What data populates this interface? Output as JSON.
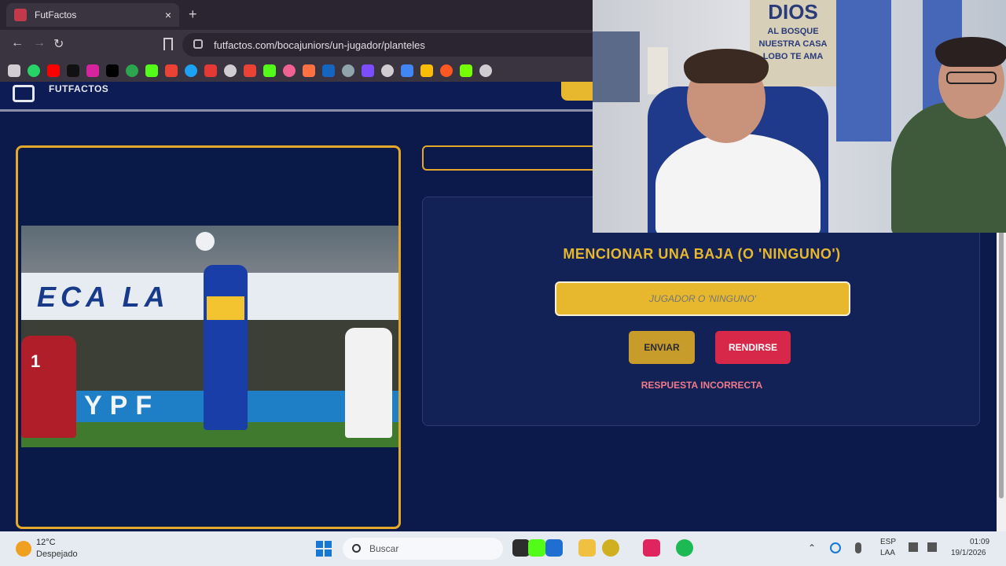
{
  "browser": {
    "tab_title": "FutFactos",
    "tab_close": "×",
    "new_tab": "+",
    "url": "futfactos.com/bocajuniors/un-jugador/planteles"
  },
  "site": {
    "name": "FUTFACTOS"
  },
  "game": {
    "question": "MENCIONAR UNA BAJA (O 'NINGUNO')",
    "input_placeholder": "JUGADOR O 'NINGUNO'",
    "input_value": "",
    "send_label": "ENVIAR",
    "giveup_label": "RENDIRSE",
    "feedback": "RESPUESTA INCORRECTA"
  },
  "photo": {
    "banner_text": "ECA LA",
    "adboard_text": "YPF",
    "player_number": "1"
  },
  "webcam": {
    "poster_title": "DIOS",
    "poster_line1": "AL BOSQUE",
    "poster_line2": "NUESTRA CASA",
    "poster_line3": "LOBO TE AMA"
  },
  "taskbar": {
    "temperature": "12°C",
    "weather": "Despejado",
    "search_placeholder": "Buscar",
    "lang_line1": "ESP",
    "lang_line2": "LAA",
    "time": "01:09",
    "date": "19/1/2026"
  },
  "colors": {
    "accent": "#e7b72d",
    "danger": "#d8284a",
    "background": "#0b1a4a"
  }
}
